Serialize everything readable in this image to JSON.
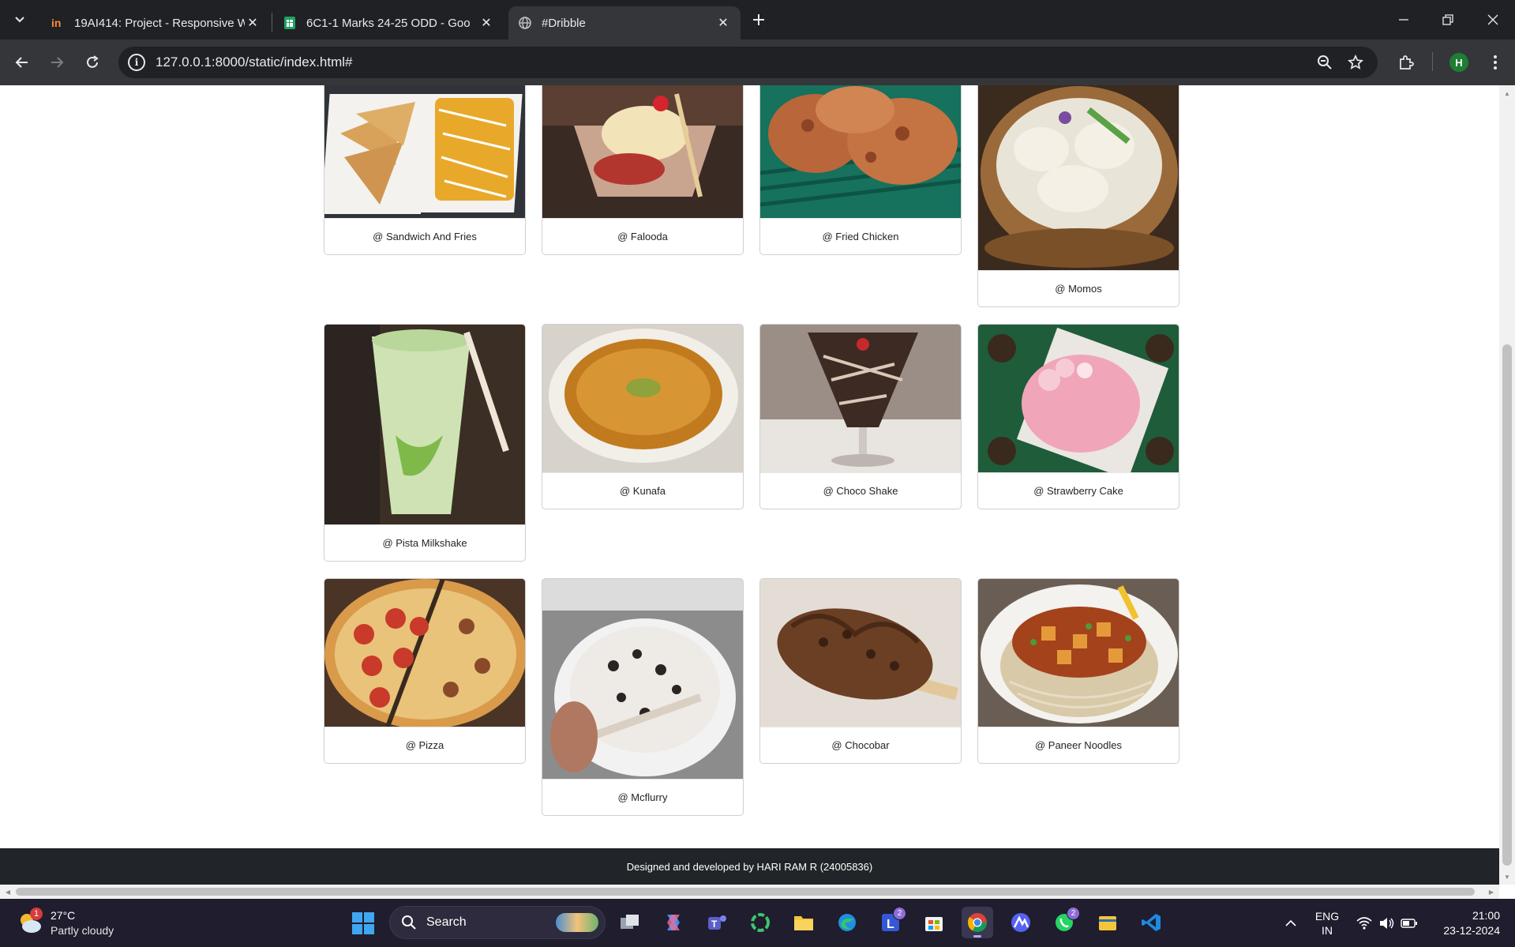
{
  "browser": {
    "tabs": [
      {
        "title": "19AI414: Project - Responsive W",
        "favicon": "invision-icon",
        "active": false
      },
      {
        "title": "6C1-1 Marks 24-25 ODD - Goo",
        "favicon": "google-sheets-icon",
        "active": false
      },
      {
        "title": "#Dribble",
        "favicon": "globe-icon",
        "active": true
      }
    ],
    "address": "127.0.0.1:8000/static/index.html#",
    "profile_initial": "H"
  },
  "gallery": {
    "items": [
      {
        "caption": "@ Sandwich And Fries"
      },
      {
        "caption": "@ Falooda"
      },
      {
        "caption": "@ Fried Chicken"
      },
      {
        "caption": "@ Momos"
      },
      {
        "caption": "@ Pista Milkshake"
      },
      {
        "caption": "@ Kunafa"
      },
      {
        "caption": "@ Choco Shake"
      },
      {
        "caption": "@ Strawberry Cake"
      },
      {
        "caption": "@ Pizza"
      },
      {
        "caption": "@ Mcflurry"
      },
      {
        "caption": "@ Chocobar"
      },
      {
        "caption": "@ Paneer Noodles"
      }
    ]
  },
  "footer": {
    "text": "Designed and developed by HARI RAM R (24005836)"
  },
  "taskbar": {
    "weather_temp": "27°C",
    "weather_condition": "Partly cloudy",
    "weather_badge": "1",
    "search_label": "Search",
    "teams_badge": "2",
    "whatsapp_badge": "2",
    "language_line1": "ENG",
    "language_line2": "IN",
    "time": "21:00",
    "date": "23-12-2024"
  }
}
